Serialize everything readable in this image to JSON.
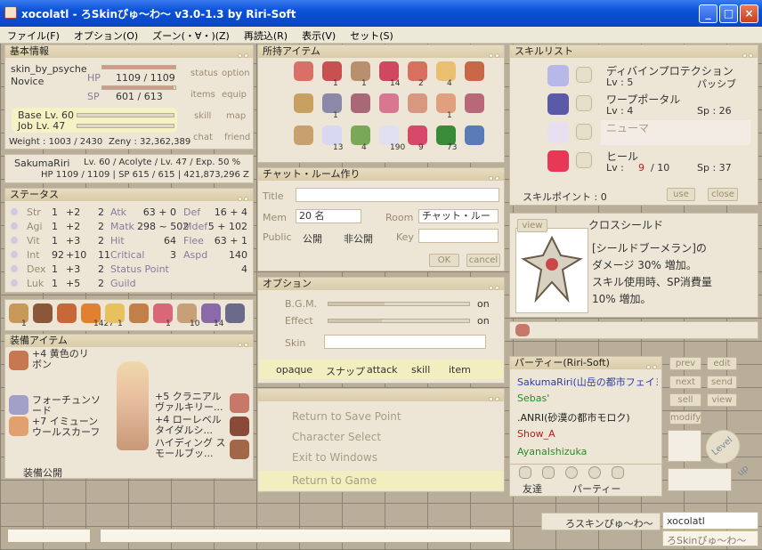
{
  "window": {
    "title": "xocolatl - ろSkinぴゅ～わ～ v3.0-1.3 by Riri-Soft",
    "min": "_",
    "max": "□",
    "close": "×"
  },
  "menu": [
    "ファイル(F)",
    "オプション(O)",
    "ズーン(・∀・)(Z)",
    "再読込(R)",
    "表示(V)",
    "セット(S)"
  ],
  "basic": {
    "header": "基本情報",
    "skin": "skin_by_psyche",
    "job": "Novice",
    "hp_label": "HP",
    "hp": "1109 / 1109",
    "hp_fill": 1.0,
    "sp_label": "SP",
    "sp": "601 / 613",
    "sp_fill": 0.98,
    "base": "Base Lv. 60",
    "joblv": "Job Lv. 47",
    "weight": "Weight : 1003 / 2430",
    "zeny": "Zeny : 32,362,389",
    "buttons": [
      "status",
      "option",
      "items",
      "equip",
      "skill",
      "map",
      "chat",
      "friend"
    ]
  },
  "char": {
    "name": "SakumaRiri",
    "lv": "Lv. 60 / Acolyte / Lv. 47 / Exp. 50 %",
    "hpsp": "HP 1109 / 1109 | SP 615 / 615 | 421,873,296 Z"
  },
  "status": {
    "header": "ステータス",
    "rows": [
      {
        "s": "Str",
        "a": "1",
        "b": "+2",
        "c": "2",
        "n": "Atk",
        "v": "63 + 0",
        "n2": "Def",
        "v2": "16 + 4"
      },
      {
        "s": "Agi",
        "a": "1",
        "b": "+2",
        "c": "2",
        "n": "Matk",
        "v": "298 ~ 502",
        "n2": "Mdef",
        "v2": "5 + 102"
      },
      {
        "s": "Vit",
        "a": "1",
        "b": "+3",
        "c": "2",
        "n": "Hit",
        "v": "64",
        "n2": "Flee",
        "v2": "63 + 1"
      },
      {
        "s": "Int",
        "a": "92",
        "b": "+10",
        "c": "11",
        "n": "Critical",
        "v": "3",
        "n2": "Aspd",
        "v2": "140"
      },
      {
        "s": "Dex",
        "a": "1",
        "b": "+3",
        "c": "2",
        "n": "Status Point",
        "v": "",
        "n2": "",
        "v2": "4"
      },
      {
        "s": "Luk",
        "a": "1",
        "b": "+5",
        "c": "2",
        "n": "Guild",
        "v": "",
        "n2": "",
        "v2": ""
      }
    ]
  },
  "hotbar": {
    "counts": [
      "1",
      "",
      "",
      "1427",
      "1",
      "",
      "1",
      "10",
      "14",
      ""
    ]
  },
  "equip": {
    "header": "装備アイテム",
    "left": [
      "+4 黄色のリボン",
      "フォーチュンソード",
      "+7 イミューン ウールスカーフ"
    ],
    "right": [
      "+5 クラニアル ヴァルキリー...",
      "+4 ローレベル タイダルシ...",
      "ハイディング スモールブッ..."
    ],
    "footer": "装備公開"
  },
  "items": {
    "header": "所持アイテム",
    "counts": [
      "",
      "1",
      "1",
      "14",
      "2",
      "4",
      "",
      "",
      "1",
      "",
      "",
      "",
      "1",
      "",
      "",
      "13",
      "4",
      "190",
      "9",
      "73",
      ""
    ]
  },
  "chat": {
    "header": "チャット・ルーム作り",
    "title_label": "Title",
    "title": "",
    "mem_label": "Mem",
    "mem": "20 名",
    "room_label": "Room",
    "room": "チャット・ルーム",
    "public_label": "Public",
    "public": "公開",
    "private": "非公開",
    "key_label": "Key",
    "key": "",
    "ok": "OK",
    "cancel": "cancel"
  },
  "options": {
    "header": "オプション",
    "bgm": "B.G.M.",
    "bgm_state": "on",
    "bgm_level": 0.4,
    "effect": "Effect",
    "effect_state": "on",
    "effect_level": 0.38,
    "skin": "Skin",
    "skin_value": "",
    "toggles": [
      "opaque",
      "スナップ",
      "attack",
      "skill",
      "item"
    ]
  },
  "menubox": {
    "items": [
      "Return to Save Point",
      "Character Select",
      "Exit to Windows"
    ],
    "return": "Return to Game"
  },
  "skills": {
    "header": "スキルリスト",
    "list": [
      {
        "name": "ディバインプロテクション",
        "lv": "Lv : 5",
        "info": "パッシブ"
      },
      {
        "name": "ワープポータル",
        "lv": "Lv : 4",
        "info": "Sp : 26"
      },
      {
        "name": "ニューマ",
        "lv": "",
        "info": ""
      },
      {
        "name": "ヒール",
        "lv": "Lv :",
        "cur": "9",
        "max": "/ 10",
        "info": "Sp : 37"
      }
    ],
    "points": "スキルポイント : 0",
    "use": "use",
    "close": "close"
  },
  "desc": {
    "view": "view",
    "name": "クロスシールド",
    "lines": [
      "[シールドブーメラン]の",
      "ダメージ 30% 増加。",
      "スキル使用時、SP消費量",
      "10% 増加。"
    ]
  },
  "party": {
    "header": "パーティー(Riri-Soft)",
    "members": [
      {
        "name": "SakumaRiri(山岳の都市フェイヨン)",
        "color": "#2a3ab0"
      },
      {
        "name": "Sebas'",
        "color": "#2a8a2a"
      },
      {
        "name": ".ANRI(砂漠の都市モロク)",
        "color": "#222222"
      },
      {
        "name": "Show_A",
        "color": "#b02020"
      },
      {
        "name": "AyanaIshizuka",
        "color": "#2a8a2a"
      }
    ],
    "tabs": [
      "友達",
      "パーティー"
    ]
  },
  "side": {
    "buttons": [
      "prev",
      "edit",
      "next",
      "send",
      "sell",
      "view",
      "modify"
    ],
    "levelup": "Level up"
  },
  "bottom": {
    "chatname": "ろスキンぴゅ～わ～",
    "charname": "xocolatl",
    "skinname": "ろSkinぴゅ～わ～"
  }
}
